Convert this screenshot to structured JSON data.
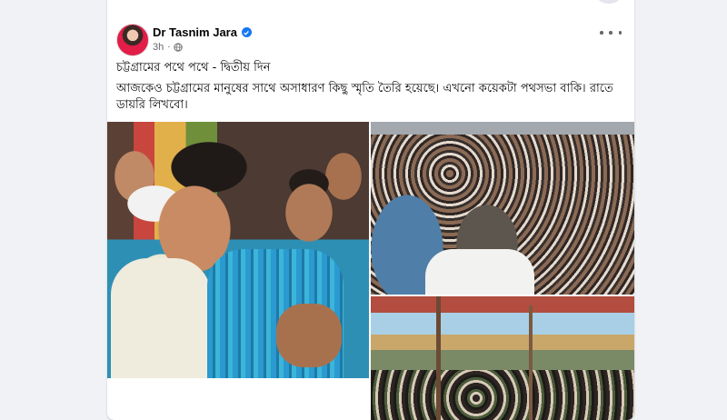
{
  "post": {
    "author": "Dr Tasnim Jara",
    "time": "3h",
    "dot": "·",
    "title": "চট্টগ্রামের পথে পথে - দ্বিতীয় দিন",
    "body": "আজকেও চট্টগ্রামের মানুষের সাথে অসাধারণ কিছু স্মৃতি তৈরি হয়েছে। এখনো কয়েকটা পথসভা বাকি। রাতে ডায়রি লিখবো।"
  },
  "icons": {
    "verified": "verified-badge-icon",
    "audience": "globe-icon",
    "more": "more-options-icon"
  },
  "colors": {
    "accent": "#1877f2",
    "text": "#050505",
    "secondary_text": "#65676b",
    "background": "#f0f2f5"
  }
}
